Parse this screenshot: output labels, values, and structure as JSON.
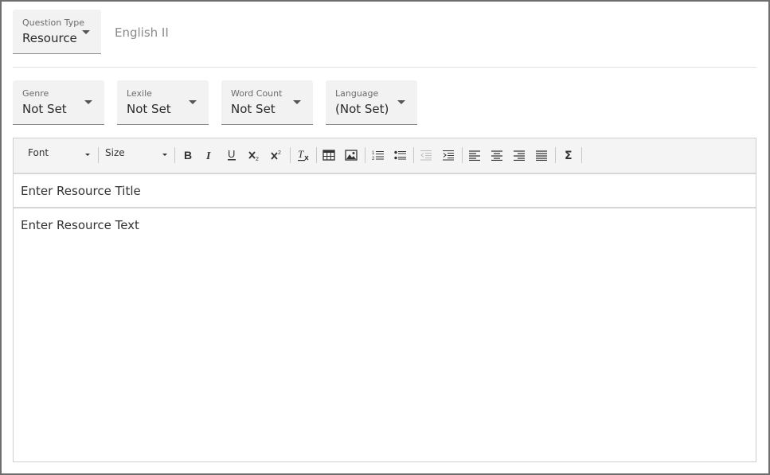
{
  "question_type": {
    "label": "Question Type",
    "value": "Resource"
  },
  "subject": "English II",
  "meta_fields": {
    "genre": {
      "label": "Genre",
      "value": "Not Set"
    },
    "lexile": {
      "label": "Lexile",
      "value": "Not Set"
    },
    "word_count": {
      "label": "Word Count",
      "value": "Not Set"
    },
    "language": {
      "label": "Language",
      "value": "(Not Set)"
    }
  },
  "toolbar": {
    "font_label": "Font",
    "size_label": "Size",
    "buttons": [
      "bold-icon",
      "italic-icon",
      "underline-icon",
      "subscript-icon",
      "superscript-icon",
      "remove-format-icon",
      "table-icon",
      "image-icon",
      "numbered-list-icon",
      "bulleted-list-icon",
      "outdent-icon",
      "indent-icon",
      "align-left-icon",
      "align-center-icon",
      "align-right-icon",
      "justify-icon",
      "sigma-icon"
    ]
  },
  "editor": {
    "title_placeholder": "Enter Resource Title",
    "text_placeholder": "Enter Resource Text"
  }
}
